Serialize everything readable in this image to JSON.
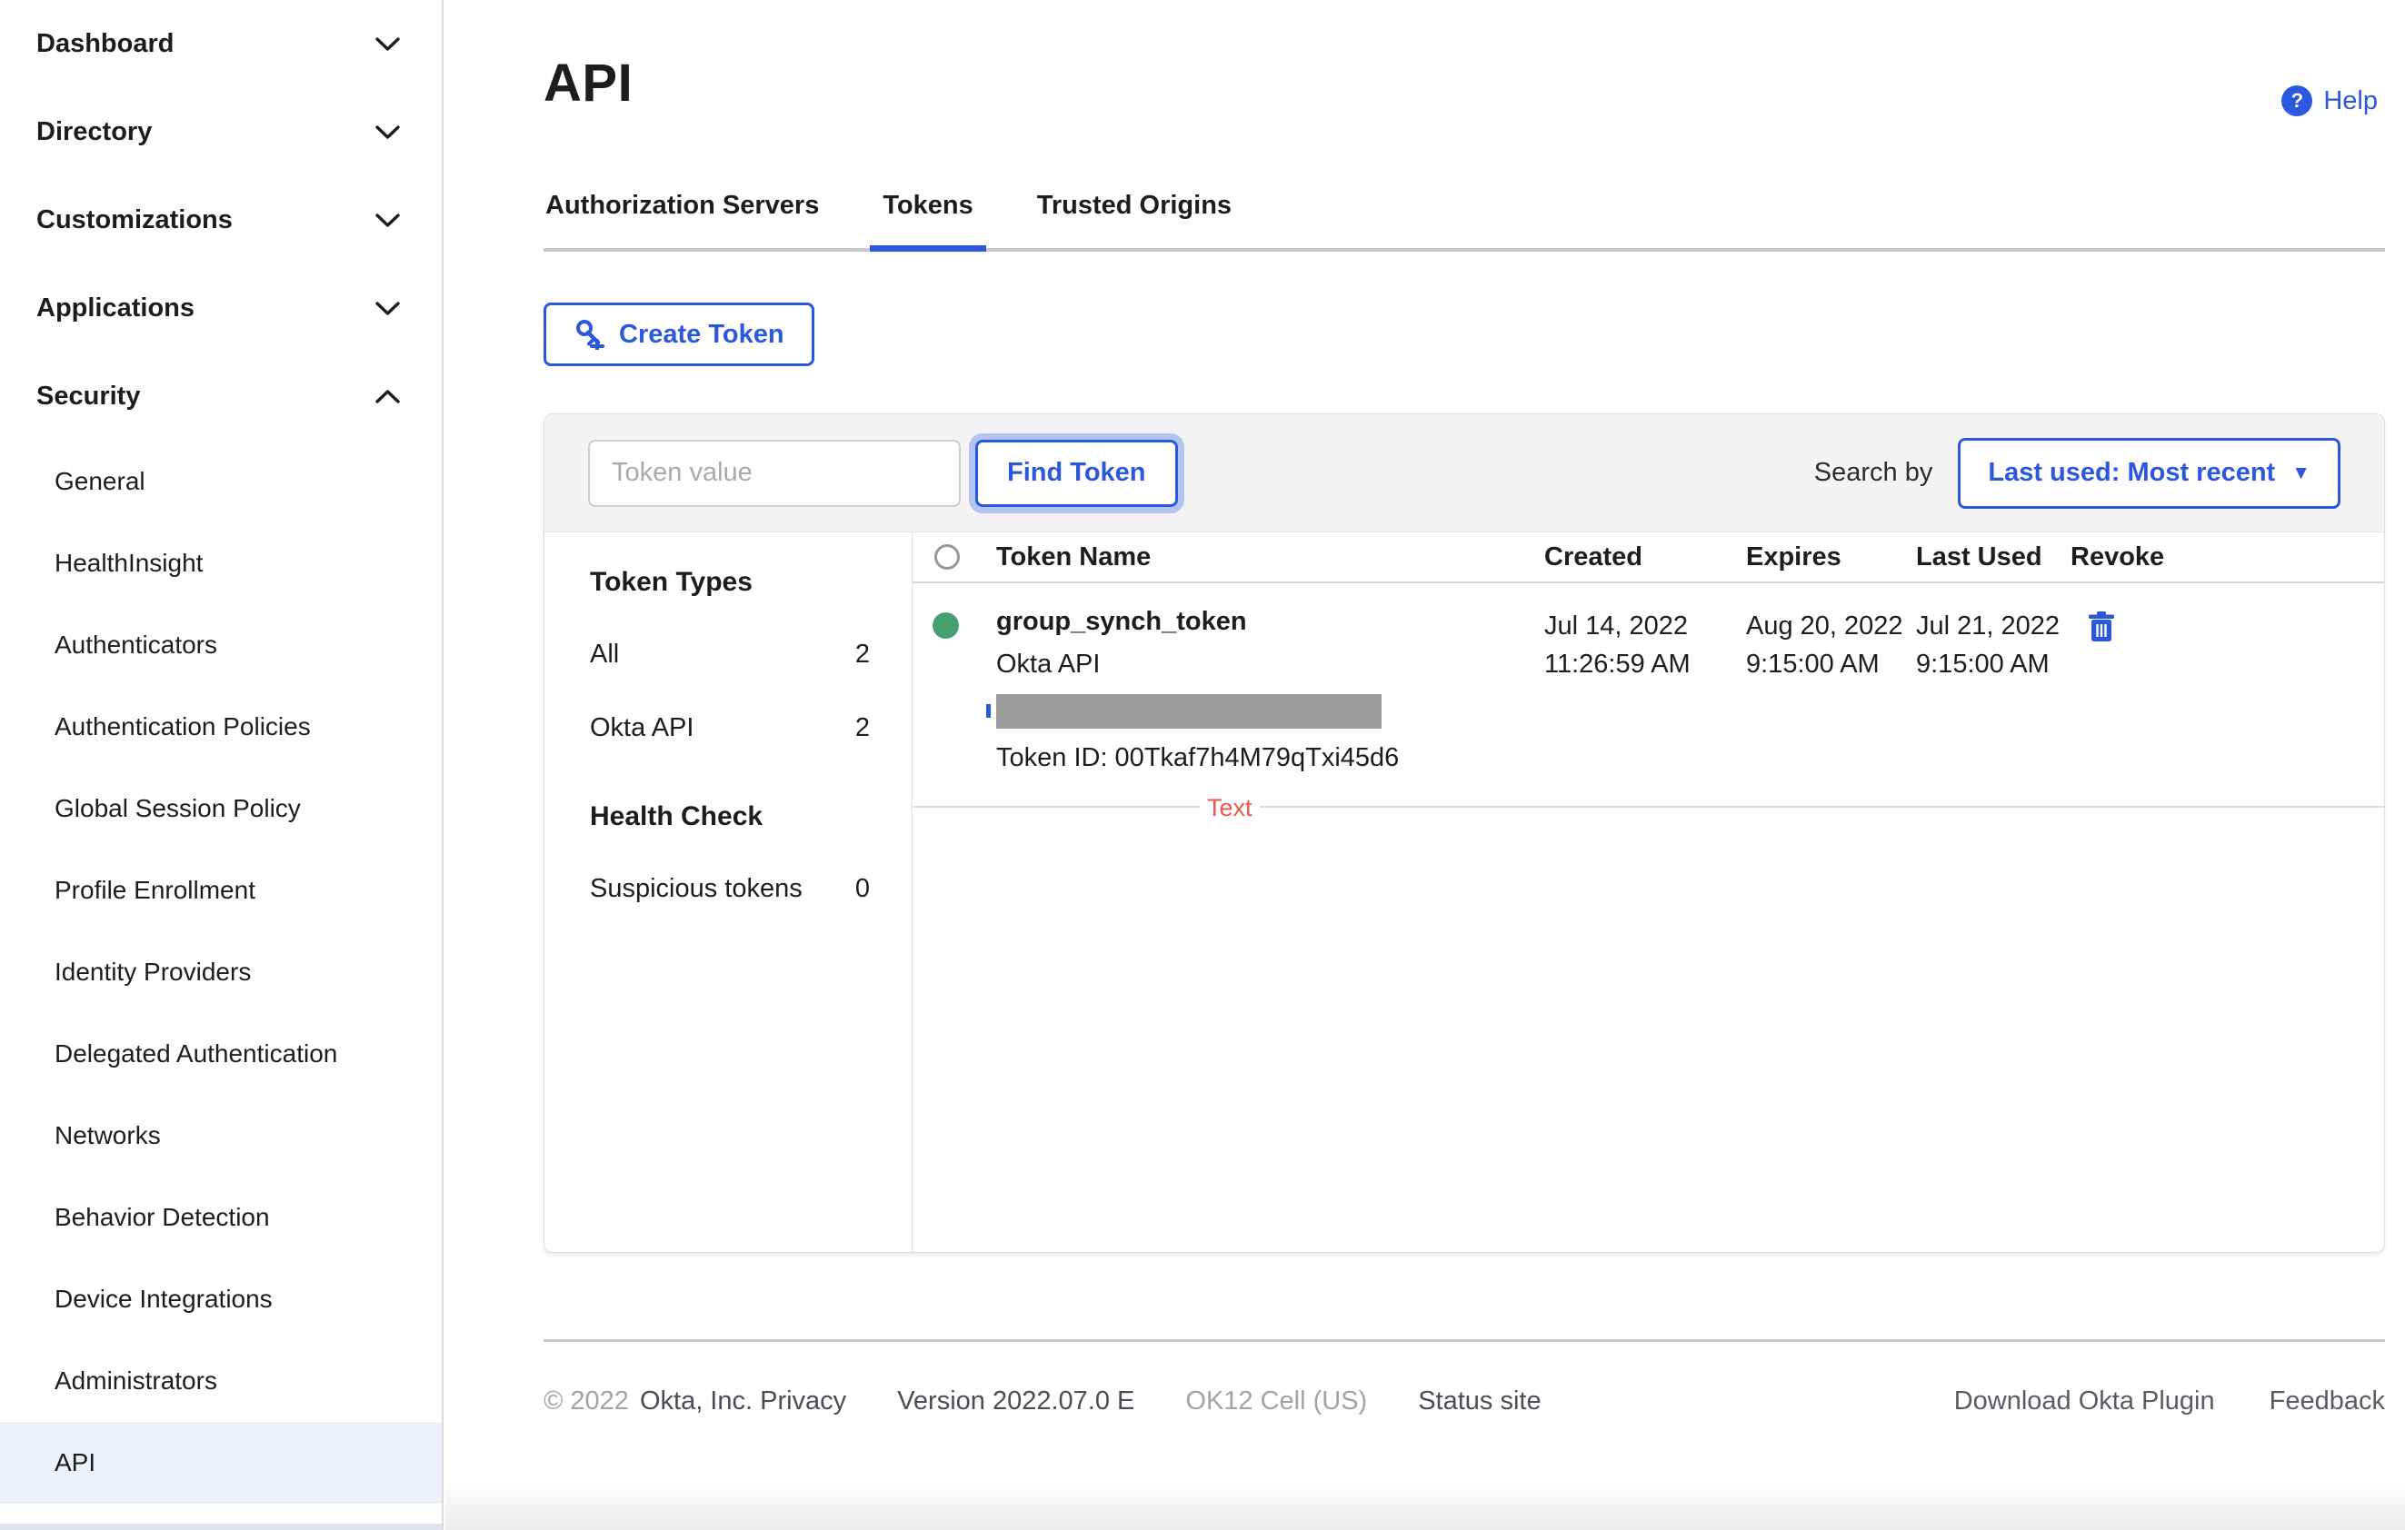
{
  "sidebar": {
    "items": [
      {
        "label": "Dashboard"
      },
      {
        "label": "Directory"
      },
      {
        "label": "Customizations"
      },
      {
        "label": "Applications"
      },
      {
        "label": "Security"
      }
    ],
    "security_children": [
      {
        "label": "General"
      },
      {
        "label": "HealthInsight"
      },
      {
        "label": "Authenticators"
      },
      {
        "label": "Authentication Policies"
      },
      {
        "label": "Global Session Policy"
      },
      {
        "label": "Profile Enrollment"
      },
      {
        "label": "Identity Providers"
      },
      {
        "label": "Delegated Authentication"
      },
      {
        "label": "Networks"
      },
      {
        "label": "Behavior Detection"
      },
      {
        "label": "Device Integrations"
      },
      {
        "label": "Administrators"
      },
      {
        "label": "API"
      }
    ],
    "selected_item": "API"
  },
  "header": {
    "title": "API",
    "help_label": "Help",
    "help_icon": "?"
  },
  "tabs": [
    {
      "label": "Authorization Servers",
      "active": false
    },
    {
      "label": "Tokens",
      "active": true
    },
    {
      "label": "Trusted Origins",
      "active": false
    }
  ],
  "toolbar": {
    "create_token_label": "Create Token"
  },
  "filter": {
    "token_value_placeholder": "Token value",
    "find_token_label": "Find Token",
    "search_by_label": "Search by",
    "sort_value": "Last used: Most recent",
    "sort_caret": "▼"
  },
  "token_types": {
    "title": "Token Types",
    "items": [
      {
        "label": "All",
        "count": "2"
      },
      {
        "label": "Okta API",
        "count": "2"
      }
    ],
    "health_title": "Health Check",
    "health_items": [
      {
        "label": "Suspicious tokens",
        "count": "0"
      }
    ]
  },
  "table": {
    "columns": [
      "Token Name",
      "Created",
      "Expires",
      "Last Used",
      "Revoke"
    ],
    "rows": [
      {
        "name": "group_synch_token",
        "type": "Okta API",
        "token_id": "Token ID: 00Tkaf7h4M79qTxi45d6",
        "created_date": "Jul 14, 2022",
        "created_time": "11:26:59 AM",
        "expires_date": "Aug 20, 2022",
        "expires_time": "9:15:00 AM",
        "last_used_date": "Jul 21, 2022",
        "last_used_time": "9:15:00 AM"
      }
    ],
    "annotation": "Text"
  },
  "footer": {
    "copyright": "© 2022",
    "company_privacy": "Okta, Inc. Privacy",
    "version": "Version 2022.07.0 E",
    "cell": "OK12 Cell (US)",
    "status_site": "Status site",
    "download_plugin": "Download Okta Plugin",
    "feedback": "Feedback"
  },
  "colors": {
    "accent": "#2b58dc",
    "status_green": "#42a16e",
    "annotation_red": "#f2554d",
    "selected_bg": "#edf1fa"
  }
}
